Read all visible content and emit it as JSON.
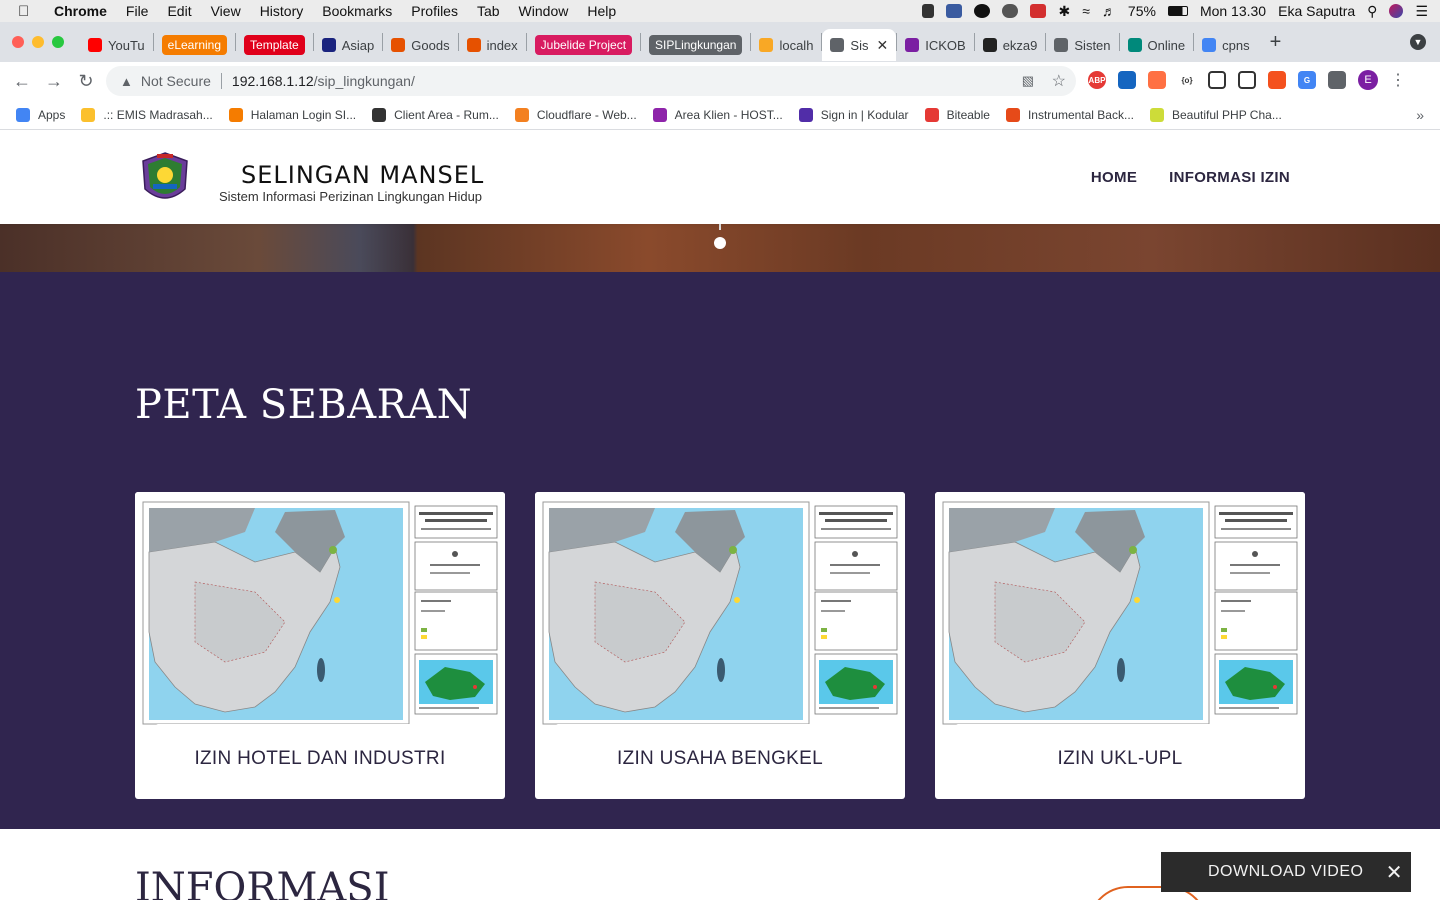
{
  "menubar": {
    "app": "Chrome",
    "items": [
      "File",
      "Edit",
      "View",
      "History",
      "Bookmarks",
      "Profiles",
      "Tab",
      "Window",
      "Help"
    ],
    "battery": "75%",
    "clock": "Mon 13.30",
    "user": "Eka Saputra"
  },
  "tabs": [
    {
      "label": "YouTu",
      "color": "#ff0000"
    },
    {
      "label": "eLearning",
      "color": "#f57c00",
      "pill": true
    },
    {
      "label": "Template",
      "color": "#e0001b",
      "pill": true
    },
    {
      "label": "Asiap",
      "color": "#1a237e"
    },
    {
      "label": "Goods",
      "color": "#e65100"
    },
    {
      "label": "index",
      "color": "#e65100"
    },
    {
      "label": "Jubelide Project",
      "color": "#d81b60",
      "pill": true
    },
    {
      "label": "SIPLingkungan",
      "color": "#5f6368",
      "pill": true
    },
    {
      "label": "localh",
      "color": "#f9a825"
    },
    {
      "label": "Sis",
      "color": "#5f6368",
      "active": true
    },
    {
      "label": "ICKOB",
      "color": "#7b1fa2"
    },
    {
      "label": "ekza9",
      "color": "#222222"
    },
    {
      "label": "Sisten",
      "color": "#5f6368"
    },
    {
      "label": "Online",
      "color": "#00897b"
    },
    {
      "label": "cpns",
      "color": "#4285f4"
    }
  ],
  "toolbar": {
    "security": "Not Secure",
    "url_host": "192.168.1.12",
    "url_path": "/sip_lingkungan/",
    "profile_initial": "E"
  },
  "bookmarks": [
    {
      "label": "Apps",
      "color": "#4285f4"
    },
    {
      "label": ".:: EMIS Madrasah...",
      "color": "#fbc02d"
    },
    {
      "label": "Halaman Login SI...",
      "color": "#f57c00"
    },
    {
      "label": "Client Area - Rum...",
      "color": "#333333"
    },
    {
      "label": "Cloudflare - Web...",
      "color": "#f38020"
    },
    {
      "label": "Area Klien - HOST...",
      "color": "#8e24aa"
    },
    {
      "label": "Sign in | Kodular",
      "color": "#512da8"
    },
    {
      "label": "Biteable",
      "color": "#e53935"
    },
    {
      "label": "Instrumental Back...",
      "color": "#e64a19"
    },
    {
      "label": "Beautiful PHP Cha...",
      "color": "#cddc39"
    }
  ],
  "site": {
    "brand": "SELINGAN MANSEL",
    "tagline": "Sistem Informasi Perizinan Lingkungan Hidup",
    "nav": [
      "HOME",
      "INFORMASI IZIN"
    ],
    "sebaran_title": "PETA SEBARAN",
    "cards": [
      {
        "caption": "IZIN HOTEL DAN INDUSTRI"
      },
      {
        "caption": "IZIN USAHA BENGKEL"
      },
      {
        "caption": "IZIN UKL-UPL"
      }
    ],
    "info_title": "INFORMASI",
    "download_video": "DOWNLOAD VIDEO"
  },
  "colors": {
    "section_bg": "#30254f",
    "nav_text": "#2c2640",
    "accent_orange": "#e0621f"
  }
}
